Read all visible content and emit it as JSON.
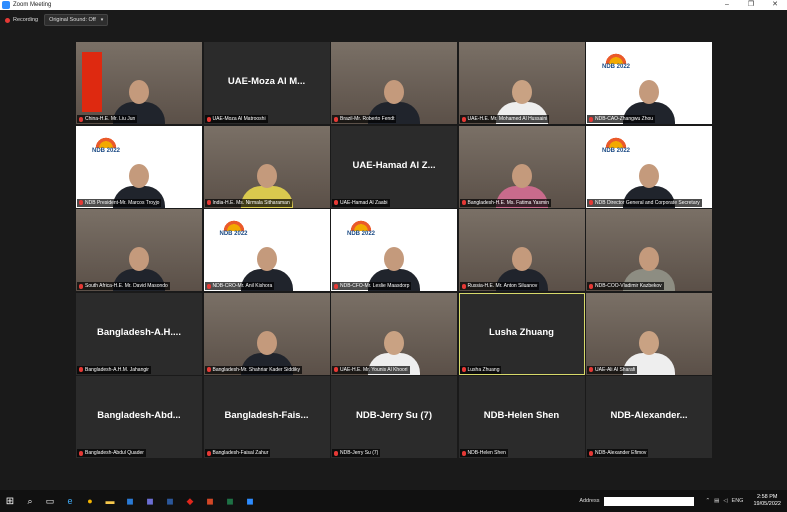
{
  "window": {
    "title": "Zoom Meeting",
    "controls": [
      "–",
      "❐",
      "✕"
    ]
  },
  "toolbar": {
    "recording_label": "Recording",
    "sound_button_label": "Original Sound: Off"
  },
  "tiles": [
    {
      "name": "China-H.E. Mr. Liu Jun",
      "display": "",
      "kind": "video",
      "flag": "china"
    },
    {
      "name": "UAE-Moza Al Matrooshi",
      "display": "UAE-Moza Al M...",
      "kind": "name"
    },
    {
      "name": "Brazil-Mr. Roberto Fendt",
      "display": "",
      "kind": "video-library"
    },
    {
      "name": "UAE-H.E. Mr. Mohamed Al Hussaini",
      "display": "",
      "kind": "video-white"
    },
    {
      "name": "NDB-CAO-Zhangwu Zhou",
      "display": "",
      "kind": "ndb"
    },
    {
      "name": "NDB President-Mr. Marcos Troyjo",
      "display": "",
      "kind": "ndb"
    },
    {
      "name": "India-H.E. Ms. Nirmala Sitharaman",
      "display": "",
      "kind": "video-sari"
    },
    {
      "name": "UAE-Hamad Al Zaabi",
      "display": "UAE-Hamad Al Z...",
      "kind": "name"
    },
    {
      "name": "Bangladesh-H.E. Ms. Fatima Yasmin",
      "display": "",
      "kind": "video-pink"
    },
    {
      "name": "NDB Director General and Corporate Secretary",
      "display": "",
      "kind": "ndb"
    },
    {
      "name": "South Africa-H.E. Mr. David Masondo",
      "display": "",
      "kind": "video"
    },
    {
      "name": "NDB-CRO-Mr. Anil Kishora",
      "display": "",
      "kind": "ndb"
    },
    {
      "name": "NDB-CFO-Mr. Leslie Maasdorp",
      "display": "",
      "kind": "ndb"
    },
    {
      "name": "Russia-H.E. Mr. Anton Siluanov",
      "display": "",
      "kind": "video"
    },
    {
      "name": "NDB-COO-Vladimir Kazbekov",
      "display": "",
      "kind": "video-grey"
    },
    {
      "name": "Bangladesh-A.H.M. Jahangir",
      "display": "Bangladesh-A.H....",
      "kind": "name"
    },
    {
      "name": "Bangladesh-Mr. Shahriar Kader Siddiky",
      "display": "",
      "kind": "video"
    },
    {
      "name": "UAE-H.E. Mr. Younis Al Khoori",
      "display": "",
      "kind": "video-white"
    },
    {
      "name": "Lusha Zhuang",
      "display": "Lusha Zhuang",
      "kind": "name",
      "active": true
    },
    {
      "name": "UAE-Ali Al Sharafi",
      "display": "",
      "kind": "video-white"
    },
    {
      "name": "Bangladesh-Abdul Quader",
      "display": "Bangladesh-Abd...",
      "kind": "name"
    },
    {
      "name": "Bangladesh-Faisal Zahur",
      "display": "Bangladesh-Fais...",
      "kind": "name"
    },
    {
      "name": "NDB-Jerry Su (7)",
      "display": "NDB-Jerry Su (7)",
      "kind": "name"
    },
    {
      "name": "NDB-Helen Shen",
      "display": "NDB-Helen Shen",
      "kind": "name"
    },
    {
      "name": "NDB-Alexander Efimov",
      "display": "NDB-Alexander...",
      "kind": "name"
    }
  ],
  "ndb_logo": {
    "text": "NDB 2022"
  },
  "taskbar": {
    "address_label": "Address",
    "language": "ENG",
    "time": "2:58 PM",
    "date": "19/05/2022"
  },
  "colors": {
    "active_speaker_border": "#d7d96a",
    "mic_muted": "#e53935",
    "tile_bg": "#2b2b2b"
  }
}
